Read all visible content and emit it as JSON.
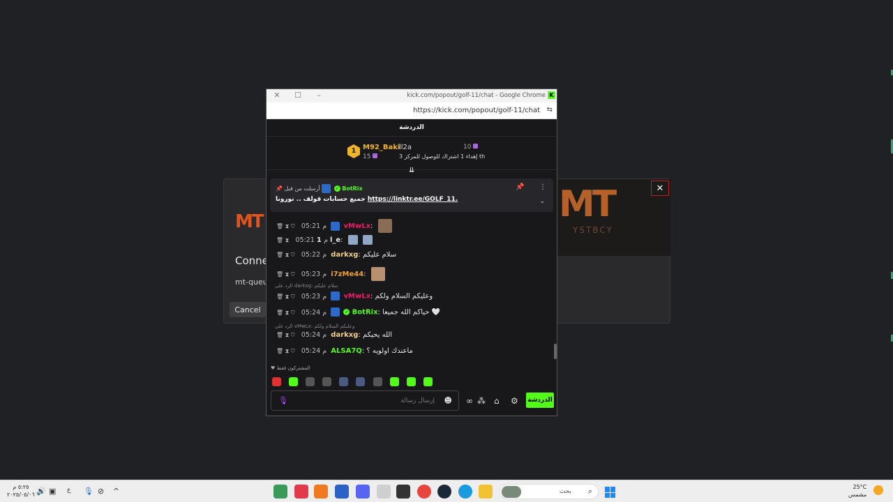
{
  "background_dialog": {
    "logo_text": "MT",
    "right_logo_text": "MT",
    "right_logo_sub": "YSTBCY",
    "title": "Conne",
    "subtitle": "mt-queue",
    "cancel_label": "Cancel",
    "close_glyph": "✕"
  },
  "popup": {
    "window_title": "kick.com/popout/golf-11/chat - Google Chrome",
    "url": "https://kick.com/popout/golf-11/chat",
    "header_title": "الدردشة",
    "leaderboard": {
      "rank1": "1",
      "name1": "M92_Baki",
      "count1": "15",
      "name2": "ll2a",
      "count2": "10",
      "note": "إهداء 1 اشتراك للوصول للمركز 3 th"
    },
    "pinned": {
      "sender": "BotRix",
      "sent_by": "أرسلت من قبل",
      "link": "https://linktr.ee/GOLF_11.",
      "text": "جميع حسابات قولف .. نورونا"
    },
    "messages": [
      {
        "time": "05:21 م",
        "user": "vMwLx",
        "color": "#e91e63",
        "text": ""
      },
      {
        "time": "05:21 م",
        "user": "1l_e",
        "color": "#e8e8e8",
        "text": ""
      },
      {
        "time": "05:22 م",
        "user": "darkxg",
        "color": "#f5d08b",
        "text": "سلام عليكم"
      },
      {
        "time": "05:23 م",
        "user": "i7zMe44",
        "color": "#f0a030",
        "text": ""
      },
      {
        "time": "05:23 م",
        "user": "vMwLx",
        "color": "#e91e63",
        "text": "وعليكم السلام ولكم"
      },
      {
        "time": "05:24 م",
        "user": "BotRix",
        "color": "#53fc18",
        "text": "حياكم الله جميعا 🤍"
      },
      {
        "time": "05:24 م",
        "user": "darkxg",
        "color": "#f5d08b",
        "text": "الله يحيكم"
      },
      {
        "time": "05:24 م",
        "user": "ALSA7Q",
        "color": "#53fc18",
        "text": "ماعندك اولويه ؟"
      }
    ],
    "replies": [
      "الرد على darkxg: سلام عليكم",
      "الرد على vMwLx: وعليكم السلام ولكم"
    ],
    "subs_only": "المشتركون فقط",
    "input_placeholder": "إرسال رسالة",
    "send_label": "الدردشة"
  },
  "taskbar": {
    "time": "٥:٢٥ م",
    "date": "٢٠٢٥/٠٥/٠٦",
    "lang": "ع",
    "search_placeholder": "بحث",
    "temp": "25°C",
    "weather": "مشمس"
  }
}
